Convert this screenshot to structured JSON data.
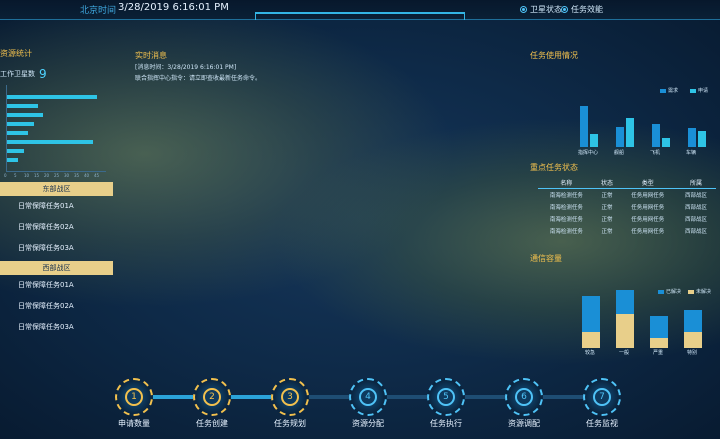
{
  "header": {
    "time_label": "北京时间",
    "time_value": "3/28/2019 6:16:01 PM",
    "toggles": [
      {
        "label": "卫星状态",
        "on": true
      },
      {
        "label": "任务效能",
        "on": false
      }
    ]
  },
  "left": {
    "title": "资源统计",
    "count_label": "工作卫星数",
    "count_value": "9",
    "bar_values": [
      0.95,
      0.33,
      0.38,
      0.28,
      0.22,
      0.9,
      0.18,
      0.12
    ],
    "ticks": [
      "0",
      "5",
      "10",
      "15",
      "20",
      "25",
      "30",
      "35",
      "40",
      "45"
    ],
    "regions": [
      {
        "name": "东部战区",
        "tasks": [
          "日常保障任务01A",
          "日常保障任务02A",
          "日常保障任务03A"
        ]
      },
      {
        "name": "西部战区",
        "tasks": [
          "日常保障任务01A",
          "日常保障任务02A",
          "日常保障任务03A"
        ]
      }
    ]
  },
  "message": {
    "title": "实时消息",
    "lines": [
      "[消息时间：3/28/2019 6:16:01 PM]",
      "联合指挥中心指令：请立即查收最新任务命令。"
    ]
  },
  "usage": {
    "title": "任务使用情况",
    "legend": [
      "需求",
      "申请"
    ],
    "categories": [
      "指挥中心",
      "舰船",
      "飞机",
      "车辆"
    ],
    "series_a": [
      0.7,
      0.35,
      0.4,
      0.33
    ],
    "series_b": [
      0.23,
      0.5,
      0.15,
      0.28
    ]
  },
  "status": {
    "title": "重点任务状态",
    "headers": [
      "名称",
      "状态",
      "类型",
      "所属"
    ],
    "rows": [
      [
        "南海检测任务",
        "正常",
        "任务用网任务",
        "西部战区"
      ],
      [
        "南海检测任务",
        "正常",
        "任务用网任务",
        "西部战区"
      ],
      [
        "南海检测任务",
        "正常",
        "任务用网任务",
        "西部战区"
      ],
      [
        "南海检测任务",
        "正常",
        "任务用网任务",
        "西部战区"
      ]
    ]
  },
  "capacity": {
    "title": "通信容量",
    "legend": [
      "已解决",
      "未解决"
    ],
    "categories": [
      "较急",
      "一般",
      "严重",
      "特别"
    ],
    "solved": [
      0.2,
      0.42,
      0.13,
      0.2
    ],
    "unsolved": [
      0.45,
      0.3,
      0.27,
      0.27
    ]
  },
  "flow": {
    "steps": [
      "申请数量",
      "任务创建",
      "任务规划",
      "资源分配",
      "任务执行",
      "资源调配",
      "任务监视"
    ],
    "symbols": [
      "1",
      "2",
      "3",
      "4",
      "5",
      "6",
      "7"
    ]
  },
  "colors": {
    "accent": "#4fc3f7",
    "gold": "#f2c14e",
    "bar_cyan": "#2ec4e6",
    "bar_blue": "#1a8fd6",
    "stack_gold": "#e8cf8a"
  }
}
